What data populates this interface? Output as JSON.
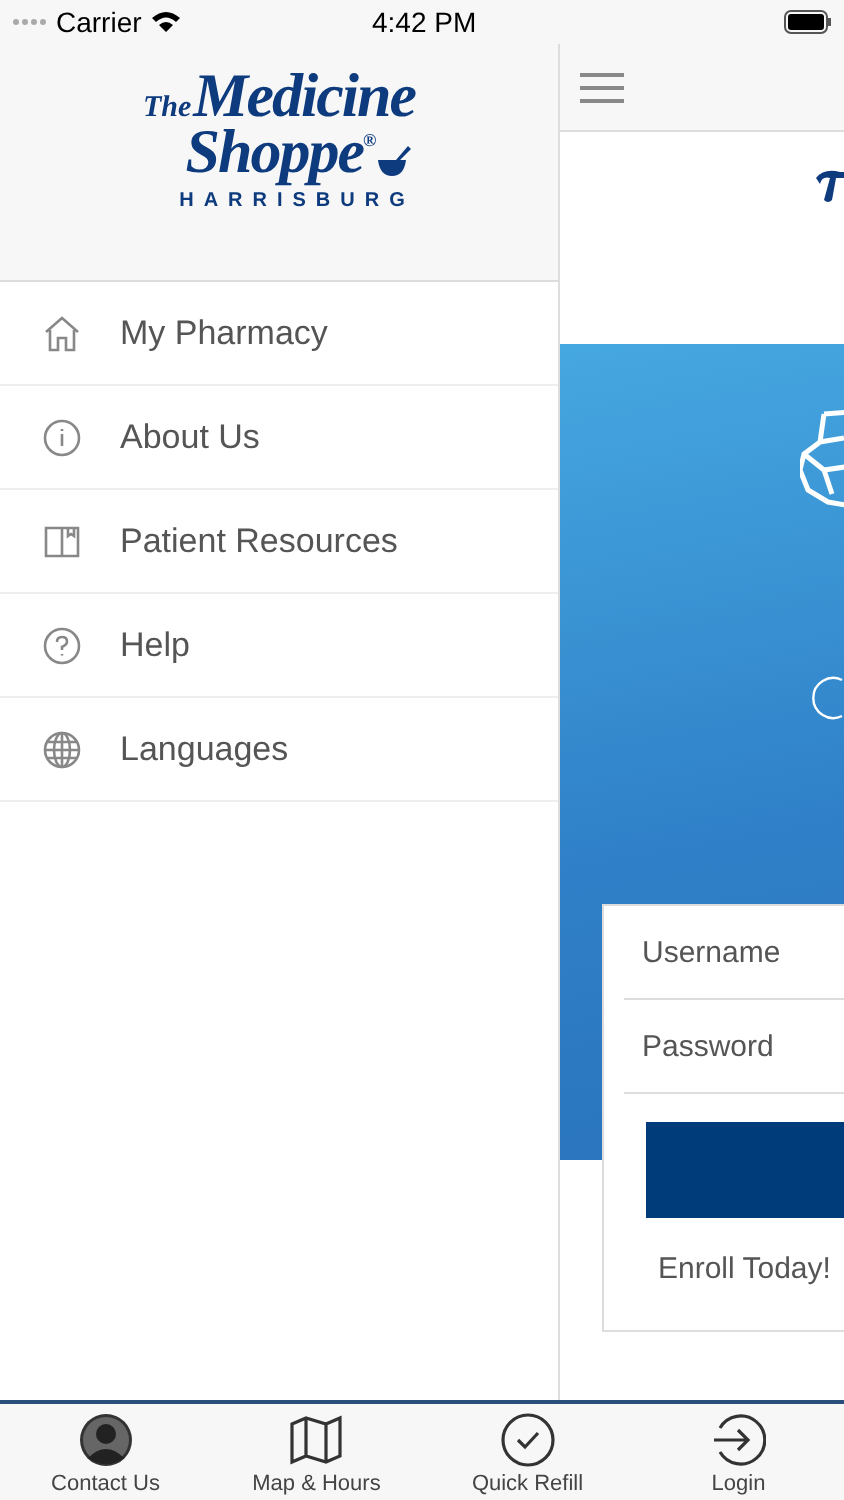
{
  "status_bar": {
    "carrier": "Carrier",
    "time": "4:42 PM"
  },
  "logo": {
    "the": "The",
    "line1": "Medicine",
    "line2": "Shoppe",
    "mark": "®",
    "location": "HARRISBURG"
  },
  "menu": [
    {
      "label": "My Pharmacy"
    },
    {
      "label": "About Us"
    },
    {
      "label": "Patient Resources"
    },
    {
      "label": "Help"
    },
    {
      "label": "Languages"
    }
  ],
  "login_form": {
    "fields": [
      {
        "placeholder": "Username"
      },
      {
        "placeholder": "Password"
      }
    ],
    "enroll_link": "Enroll Today!"
  },
  "tab_bar": [
    {
      "label": "Contact Us"
    },
    {
      "label": "Map & Hours"
    },
    {
      "label": "Quick Refill"
    },
    {
      "label": "Login"
    }
  ]
}
